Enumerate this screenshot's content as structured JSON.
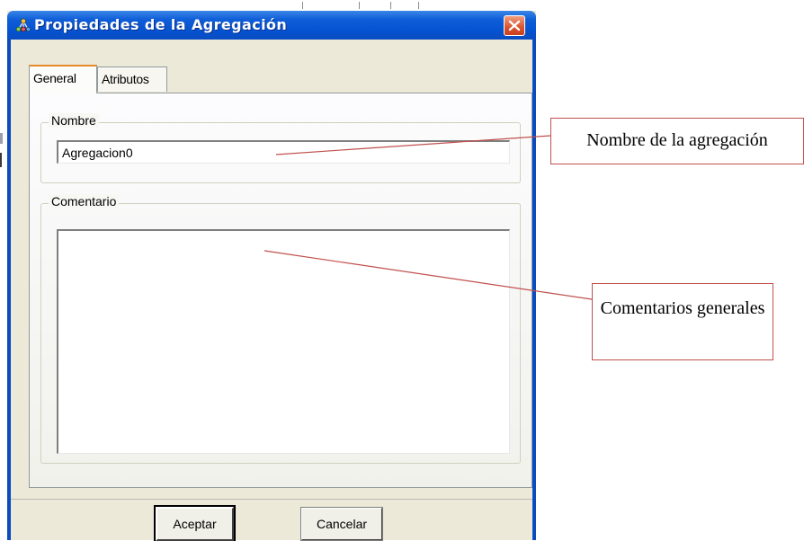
{
  "dialog": {
    "title": "Propiedades de la Agregación",
    "title_icon": "aggregation-icon",
    "close_icon": "close-icon",
    "tabs": [
      {
        "label": "General",
        "selected": true
      },
      {
        "label": "Atributos",
        "selected": false
      }
    ],
    "nombre": {
      "label": "Nombre",
      "value": "Agregacion0"
    },
    "comentario": {
      "label": "Comentario",
      "value": ""
    },
    "buttons": {
      "ok_label": "Aceptar",
      "cancel_label": "Cancelar"
    }
  },
  "annotations": {
    "nombre_callout": "Nombre de la agregación",
    "comentarios_callout": "Comentarios generales"
  },
  "colors": {
    "titlebar": "#0552d0",
    "dialog_background": "#ece9d8",
    "close_button": "#d8522f",
    "callout_border": "#c0504d"
  }
}
